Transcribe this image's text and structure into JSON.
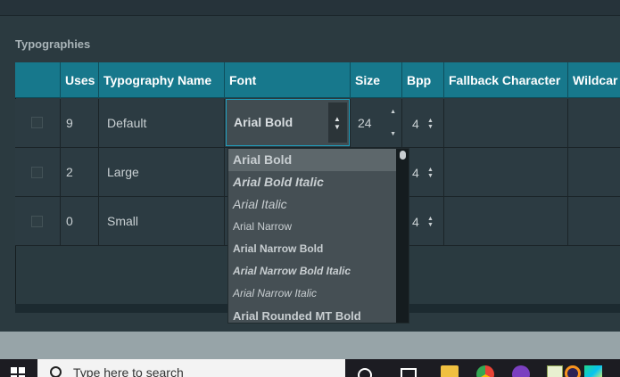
{
  "section": {
    "title": "Typographies"
  },
  "table": {
    "columns": [
      "",
      "Uses",
      "Typography Name",
      "Font",
      "Size",
      "Bpp",
      "Fallback Character",
      "Wildcar"
    ],
    "rows": [
      {
        "uses": "9",
        "name": "Default",
        "font": "Arial Bold",
        "size": "24",
        "bpp": "4"
      },
      {
        "uses": "2",
        "name": "Large",
        "bpp": "4"
      },
      {
        "uses": "0",
        "name": "Small",
        "bpp": "4"
      }
    ]
  },
  "font_dropdown": {
    "options": [
      "Arial Bold",
      "Arial Bold Italic",
      "Arial Italic",
      "Arial Narrow",
      "Arial Narrow Bold",
      "Arial Narrow Bold Italic",
      "Arial Narrow Italic",
      "Arial Rounded MT Bold"
    ],
    "selected": "Arial Bold"
  },
  "taskbar": {
    "search_placeholder": "Type here to search",
    "icons": [
      "windows-start-icon",
      "search-icon",
      "cortana-icon",
      "task-view-icon",
      "file-explorer-icon",
      "chrome-icon",
      "firefox-icon",
      "notepad-icon",
      "eclipse-icon",
      "pycharm-icon"
    ]
  },
  "colors": {
    "header": "#17788c",
    "background": "#2b3a40",
    "focus_border": "#1fa1c0"
  }
}
